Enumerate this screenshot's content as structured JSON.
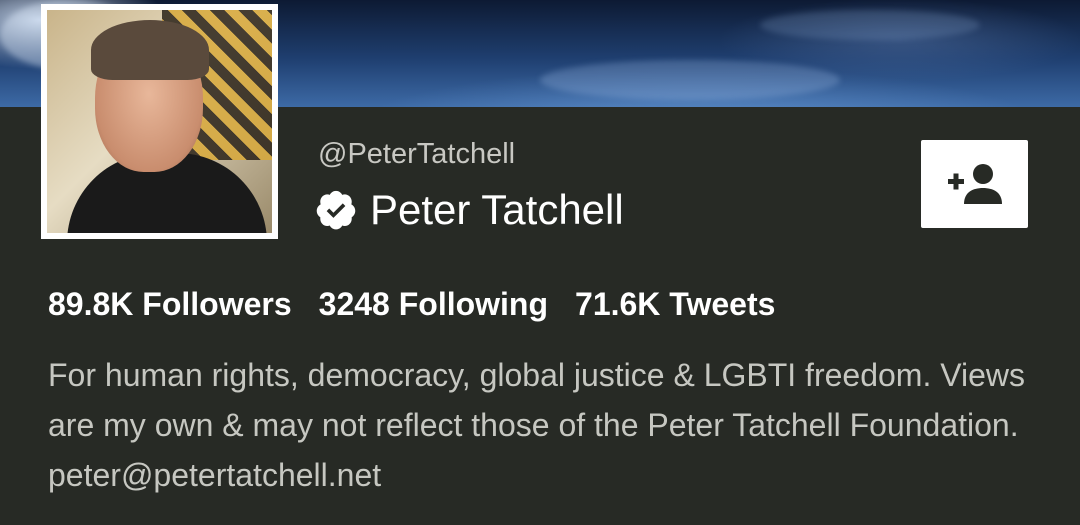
{
  "profile": {
    "handle": "@PeterTatchell",
    "name": "Peter Tatchell",
    "verified": true,
    "stats": {
      "followers": "89.8K Followers",
      "following": "3248 Following",
      "tweets": "71.6K Tweets"
    },
    "bio": "For human rights, democracy, global justice & LGBTI freedom. Views are my own & may not reflect those of the Peter Tatchell Foundation. peter@petertatchell.net"
  },
  "icons": {
    "verified": "verified-badge-icon",
    "follow": "add-person-icon"
  },
  "colors": {
    "background": "#272a25",
    "text_primary": "#ffffff",
    "text_secondary": "#c6c7c1",
    "button_bg": "#ffffff",
    "button_icon": "#272a25"
  }
}
